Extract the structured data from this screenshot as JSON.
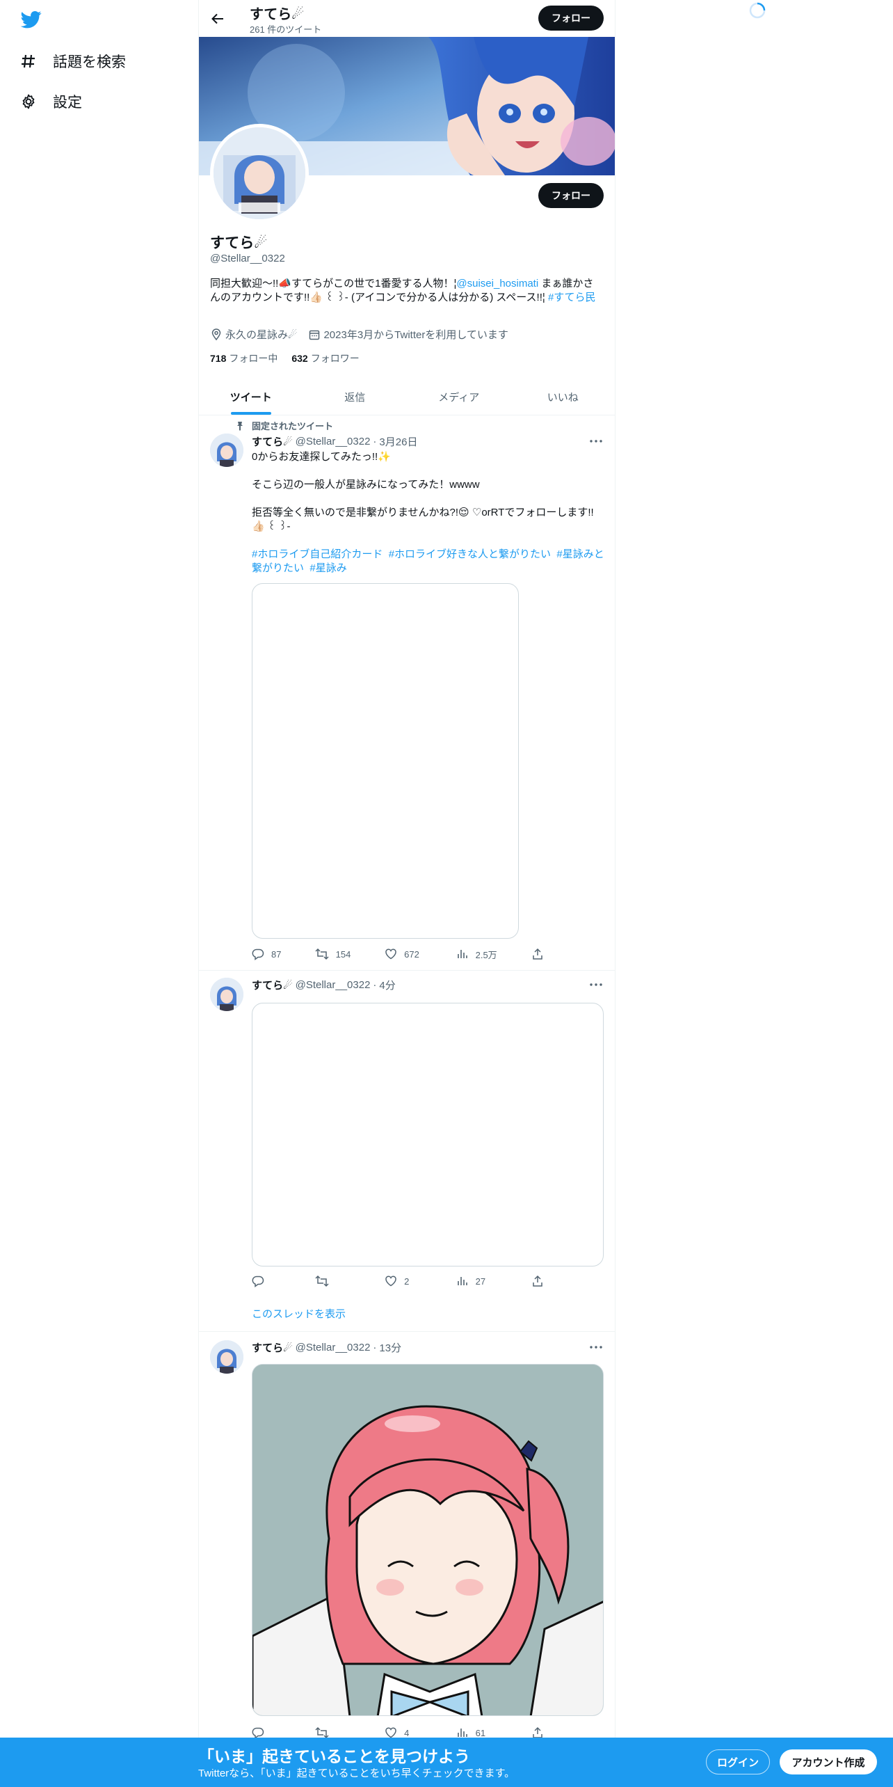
{
  "colors": {
    "accent": "#1d9bf0",
    "text": "#0f1419",
    "muted": "#536471",
    "button_dark": "#0f1419"
  },
  "sidebar": {
    "logo_icon": "twitter-bird-icon",
    "items": [
      {
        "icon": "hashtag-icon",
        "label": "話題を検索"
      },
      {
        "icon": "gear-icon",
        "label": "設定"
      }
    ]
  },
  "header": {
    "name": "すてら☄",
    "tweet_count": "261 件のツイート",
    "follow_label": "フォロー"
  },
  "profile": {
    "name": "すてら☄",
    "handle": "@Stellar__0322",
    "follow_label": "フォロー",
    "bio_text": "同担大歓迎〜!!📣すてらがこの世で1番愛する人物！¦",
    "bio_mention": "@suisei_hosimati",
    "bio_text_2": " まぁ誰かさんのアカウントです!!👍🏻 ꒰ ꒱- (アイコンで分かる人は分かる) スペース!!¦ ",
    "bio_hashtag": "#すてら民",
    "location": "永久の星詠み☄",
    "joined": "2023年3月からTwitterを利用しています",
    "following_count": "718",
    "following_label": "フォロー中",
    "followers_count": "632",
    "followers_label": "フォロワー"
  },
  "tabs": [
    {
      "label": "ツイート",
      "active": true
    },
    {
      "label": "返信"
    },
    {
      "label": "メディア"
    },
    {
      "label": "いいね"
    }
  ],
  "tweets": [
    {
      "pinned_label": "固定されたツイート",
      "name": "すてら☄",
      "handle": "@Stellar__0322",
      "time": "3月26日",
      "line1": "0からお友達探してみたっ!!✨",
      "line2": "そこら辺の一般人が星詠みになってみた！wwww",
      "line3": "拒否等全く無いので是非繋がりませんかね?!😌 ♡orRTでフォローします!!👍🏻 ꒰ ꒱-",
      "hashtags": [
        "#ホロライブ自己紹介カード",
        "#ホロライブ好きな人と繋がりたい",
        "#星詠みと繋がりたい",
        "#星詠み"
      ],
      "replies": "87",
      "retweets": "154",
      "likes": "672",
      "views": "2.5万"
    },
    {
      "name": "すてら☄",
      "handle": "@Stellar__0322",
      "time": "4分",
      "replies": "",
      "retweets": "",
      "likes": "2",
      "views": "27",
      "thread_link": "このスレッドを表示"
    },
    {
      "name": "すてら☄",
      "handle": "@Stellar__0322",
      "time": "13分",
      "replies": "",
      "retweets": "",
      "likes": "4",
      "views": "61"
    }
  ],
  "bottom_bar": {
    "title": "「いま」起きていることを見つけよう",
    "subtitle": "Twitterなら、「いま」起きていることをいち早くチェックできます。",
    "login": "ログイン",
    "signup": "アカウント作成"
  }
}
